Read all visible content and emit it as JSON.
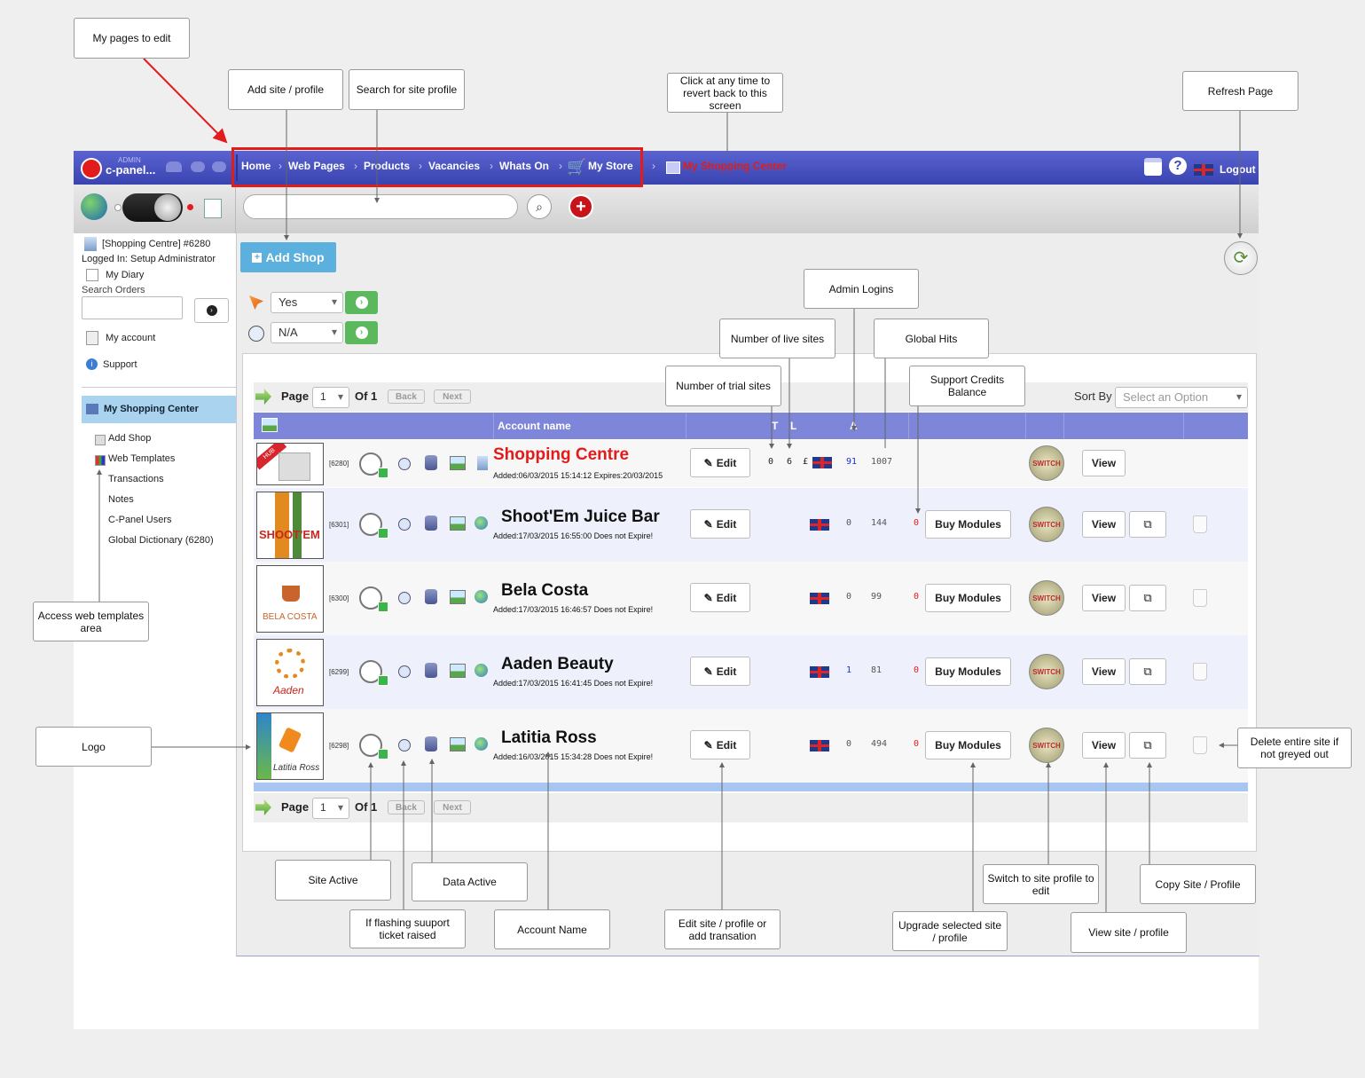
{
  "callouts": {
    "my_pages": "My pages to edit",
    "add_site": "Add site / profile",
    "search_site": "Search for site profile",
    "revert": "Click at any time to revert back to this screen",
    "refresh": "Refresh Page",
    "admin_logins": "Admin Logins",
    "live_sites": "Number of live sites",
    "global_hits": "Global Hits",
    "trial_sites": "Number of trial sites",
    "support_credits": "Support Credits Balance",
    "access_templates": "Access web templates area",
    "logo": "Logo",
    "delete_site": "Delete entire site if not greyed out",
    "site_active": "Site Active",
    "data_active": "Data Active",
    "if_flashing": "If flashing suuport ticket raised",
    "account_name": "Account Name",
    "edit_site": "Edit site / profile or add transation",
    "upgrade": "Upgrade selected site / profile",
    "switch_site": "Switch to site profile to edit",
    "view_site": "View site / profile",
    "copy_site": "Copy Site / Profile"
  },
  "topbar": {
    "logo_admin": "ADMIN",
    "logo_text": "c-panel...",
    "nav": [
      "Home",
      "Web Pages",
      "Products",
      "Vacancies",
      "Whats On",
      "My Store"
    ],
    "current": "My Shopping Center",
    "logout": "Logout"
  },
  "search": {
    "placeholder": ""
  },
  "sidebar": {
    "site": "[Shopping Centre] #6280",
    "logged_in": "Logged In: Setup Administrator",
    "my_diary": "My Diary",
    "search_orders": "Search Orders",
    "my_account": "My account",
    "support": "Support",
    "section_title": "My Shopping Center",
    "items": [
      "Add Shop",
      "Web Templates",
      "Transactions",
      "Notes",
      "C-Panel Users",
      "Global Dictionary (6280)"
    ]
  },
  "main": {
    "add_shop": "Add Shop",
    "filter1": "Yes",
    "filter2": "N/A",
    "page_label": "Page",
    "page_value": "1",
    "of_label": "Of 1",
    "back": "Back",
    "next": "Next",
    "sort_by": "Sort By",
    "sort_placeholder": "Select an Option",
    "col_account": "Account name",
    "col_t": "T",
    "col_l": "L",
    "col_a": "A"
  },
  "rows": [
    {
      "id": "[6280]",
      "name": "Shopping Centre",
      "added": "Added:06/03/2015 15:14:12  Expires:20/03/2015",
      "edit": "Edit",
      "t": "0",
      "l": "6",
      "currency": "£",
      "a": "91",
      "hits": "1007",
      "credits": "",
      "buy": "",
      "switch": "SWITCH",
      "view": "View",
      "thumb": "HUB"
    },
    {
      "id": "[6301]",
      "name": "Shoot'Em Juice Bar",
      "added": "Added:17/03/2015 16:55:00  Does not Expire!",
      "edit": "Edit",
      "a": "0",
      "hits": "144",
      "credits": "0",
      "buy": "Buy Modules",
      "switch": "SWITCH",
      "view": "View",
      "thumb": "SHOOT'EM"
    },
    {
      "id": "[6300]",
      "name": "Bela Costa",
      "added": "Added:17/03/2015 16:46:57  Does not Expire!",
      "edit": "Edit",
      "a": "0",
      "hits": "99",
      "credits": "0",
      "buy": "Buy Modules",
      "switch": "SWITCH",
      "view": "View",
      "thumb": "BELA COSTA"
    },
    {
      "id": "[6299]",
      "name": "Aaden Beauty",
      "added": "Added:17/03/2015 16:41:45  Does not Expire!",
      "edit": "Edit",
      "a": "1",
      "hits": "81",
      "credits": "0",
      "buy": "Buy Modules",
      "switch": "SWITCH",
      "view": "View",
      "thumb": "Aaden"
    },
    {
      "id": "[6298]",
      "name": "Latitia Ross",
      "added": "Added:16/03/2015 15:34:28  Does not Expire!",
      "edit": "Edit",
      "a": "0",
      "hits": "494",
      "credits": "0",
      "buy": "Buy Modules",
      "switch": "SWITCH",
      "view": "View",
      "thumb": "Latitia Ross"
    }
  ],
  "colors": {
    "nav_blue": "#4a52bf",
    "header_blue": "#7d86d8",
    "accent_red": "#e21b1b",
    "green": "#5cb85c"
  }
}
